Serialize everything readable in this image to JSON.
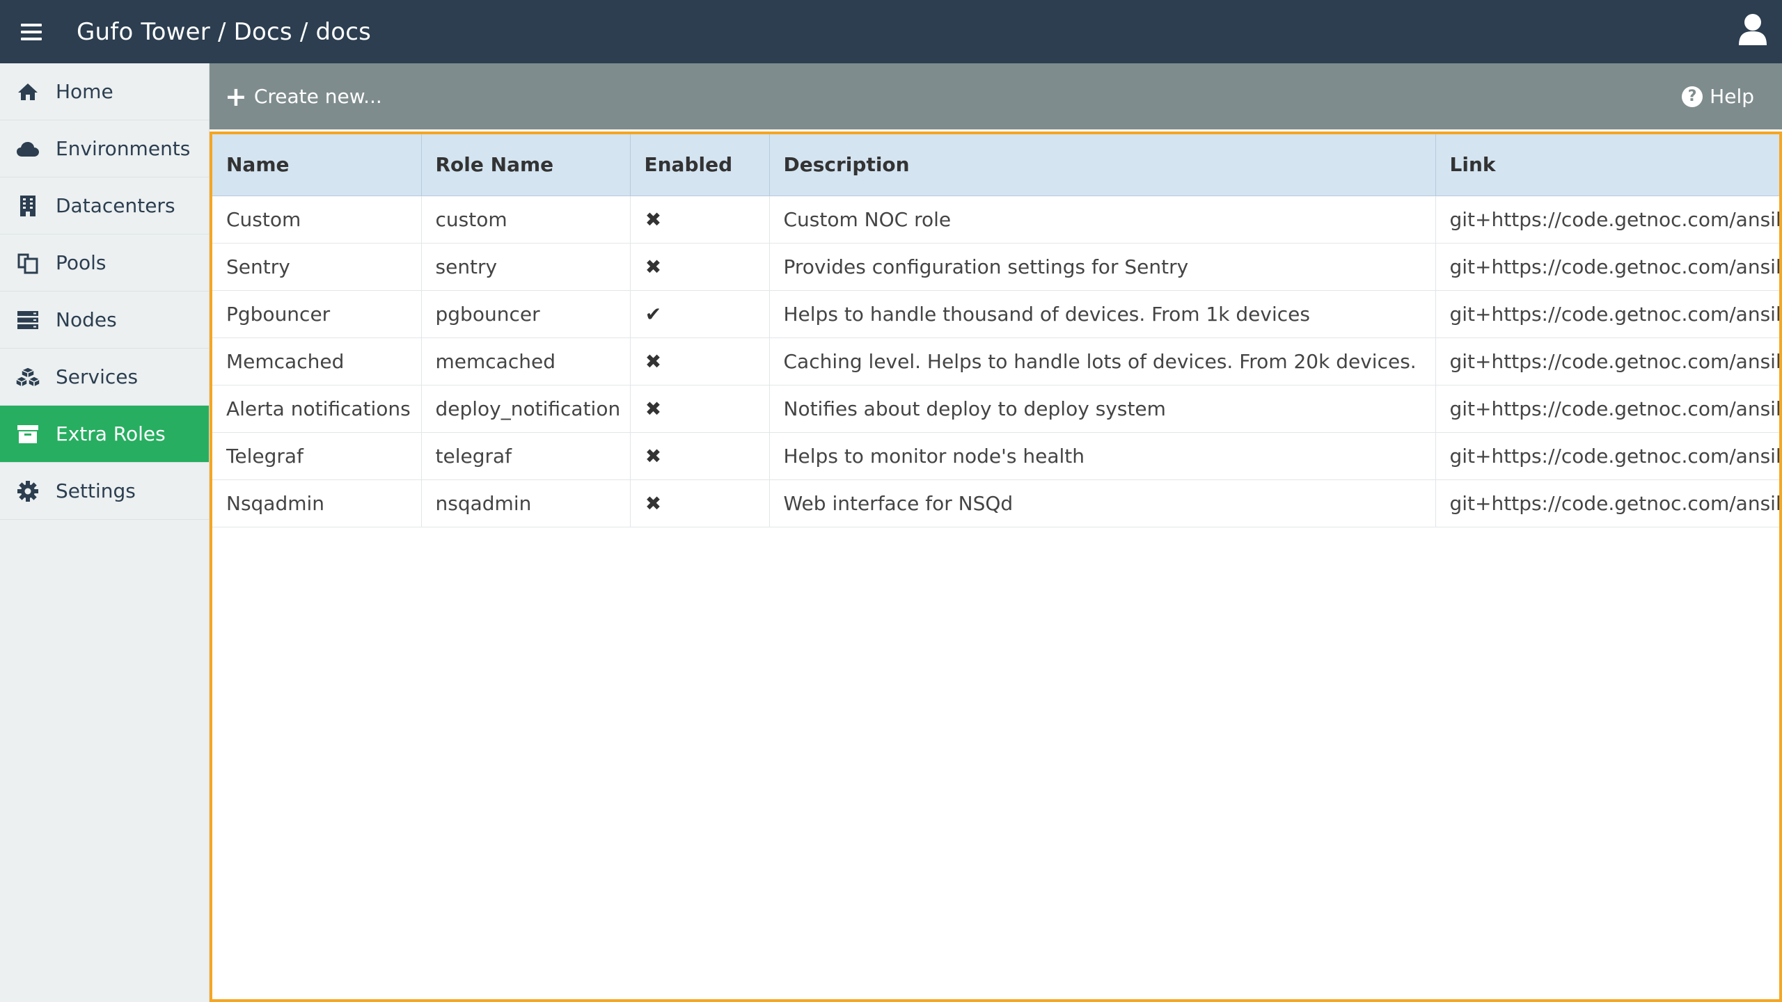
{
  "header": {
    "breadcrumb": "Gufo Tower / Docs / docs",
    "menu_icon": "hamburger-icon",
    "user_icon": "user-icon"
  },
  "sidebar": {
    "items": [
      {
        "label": "Home",
        "icon": "home-icon"
      },
      {
        "label": "Environments",
        "icon": "cloud-icon"
      },
      {
        "label": "Datacenters",
        "icon": "building-icon"
      },
      {
        "label": "Pools",
        "icon": "copy-icon"
      },
      {
        "label": "Nodes",
        "icon": "server-icon"
      },
      {
        "label": "Services",
        "icon": "cubes-icon"
      },
      {
        "label": "Extra Roles",
        "icon": "archive-icon",
        "active": true
      },
      {
        "label": "Settings",
        "icon": "gear-icon"
      }
    ]
  },
  "toolbar": {
    "create_label": "Create new...",
    "help_label": "Help"
  },
  "table": {
    "columns": [
      "Name",
      "Role Name",
      "Enabled",
      "Description",
      "Link"
    ],
    "rows": [
      {
        "name": "Custom",
        "role": "custom",
        "enabled": false,
        "description": "Custom NOC role",
        "link": "git+https://code.getnoc.com/ansible-r"
      },
      {
        "name": "Sentry",
        "role": "sentry",
        "enabled": false,
        "description": "Provides configuration settings for Sentry",
        "link": "git+https://code.getnoc.com/ansible-r"
      },
      {
        "name": "Pgbouncer",
        "role": "pgbouncer",
        "enabled": true,
        "description": "Helps to handle thousand of devices. From 1k devices",
        "link": "git+https://code.getnoc.com/ansible-r"
      },
      {
        "name": "Memcached",
        "role": "memcached",
        "enabled": false,
        "description": "Caching level. Helps to handle lots of devices. From 20k devices.",
        "link": "git+https://code.getnoc.com/ansible-r"
      },
      {
        "name": "Alerta notifications",
        "role": "deploy_notification",
        "enabled": false,
        "description": "Notifies about deploy to deploy system",
        "link": "git+https://code.getnoc.com/ansible-r"
      },
      {
        "name": "Telegraf",
        "role": "telegraf",
        "enabled": false,
        "description": "Helps to monitor node's health",
        "link": "git+https://code.getnoc.com/ansible-r"
      },
      {
        "name": "Nsqadmin",
        "role": "nsqadmin",
        "enabled": false,
        "description": "Web interface for NSQd",
        "link": "git+https://code.getnoc.com/ansible-r"
      }
    ]
  },
  "colors": {
    "topbar": "#2c3e50",
    "toolbar": "#7f8c8d",
    "active_nav": "#27ae60",
    "grid_focus_border": "#f5a623",
    "header_row": "#d4e4f1"
  }
}
